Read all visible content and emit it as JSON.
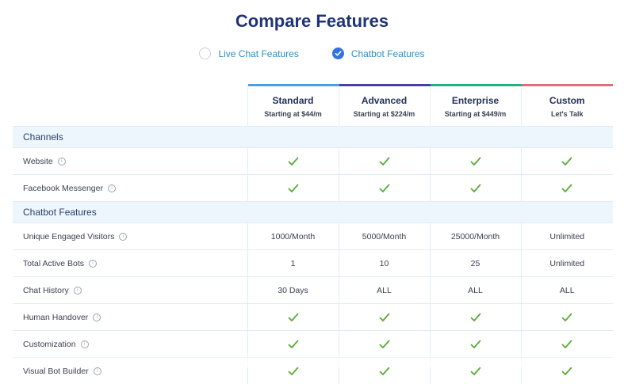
{
  "title": "Compare Features",
  "toggle": [
    {
      "label": "Live Chat Features",
      "selected": false
    },
    {
      "label": "Chatbot Features",
      "selected": true
    }
  ],
  "plans": [
    {
      "name": "Standard",
      "price": "Starting at $44/m",
      "color": "#4a9fe0"
    },
    {
      "name": "Advanced",
      "price": "Starting at $224/m",
      "color": "#4a3fa0"
    },
    {
      "name": "Enterprise",
      "price": "Starting at $449/m",
      "color": "#21b27f"
    },
    {
      "name": "Custom",
      "price": "Let's Talk",
      "color": "#e06e7a"
    }
  ],
  "sections": [
    {
      "title": "Channels",
      "rows": [
        {
          "label": "Website",
          "values": [
            "check",
            "check",
            "check",
            "check"
          ]
        },
        {
          "label": "Facebook Messenger",
          "values": [
            "check",
            "check",
            "check",
            "check"
          ]
        }
      ]
    },
    {
      "title": "Chatbot Features",
      "rows": [
        {
          "label": "Unique Engaged Visitors",
          "values": [
            "1000/Month",
            "5000/Month",
            "25000/Month",
            "Unlimited"
          ]
        },
        {
          "label": "Total Active Bots",
          "values": [
            "1",
            "10",
            "25",
            "Unlimited"
          ]
        },
        {
          "label": "Chat History",
          "values": [
            "30 Days",
            "ALL",
            "ALL",
            "ALL"
          ]
        },
        {
          "label": "Human Handover",
          "values": [
            "check",
            "check",
            "check",
            "check"
          ]
        },
        {
          "label": "Customization",
          "values": [
            "check",
            "check",
            "check",
            "check"
          ]
        },
        {
          "label": "Visual Bot Builder",
          "values": [
            "check",
            "check",
            "check",
            "check"
          ]
        }
      ]
    }
  ],
  "colors": {
    "check": "#5aab38",
    "title": "#1f3478",
    "accent": "#2a8fc4",
    "radio": "#3372e0"
  }
}
